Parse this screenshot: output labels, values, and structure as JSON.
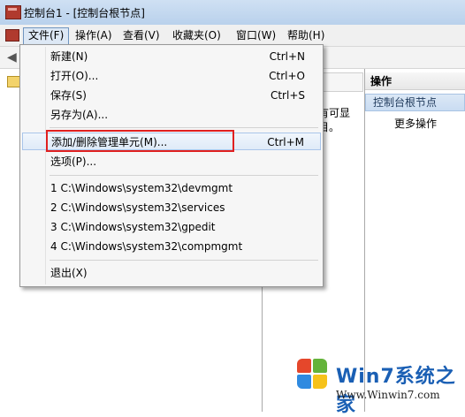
{
  "window": {
    "title": "控制台1 - [控制台根节点]"
  },
  "menubar": {
    "items": [
      {
        "label": "文件(F)"
      },
      {
        "label": "操作(A)"
      },
      {
        "label": "查看(V)"
      },
      {
        "label": "收藏夹(O)"
      },
      {
        "label": "窗口(W)"
      },
      {
        "label": "帮助(H)"
      }
    ]
  },
  "middle": {
    "line1": "有可显",
    "line2": "目。"
  },
  "actions": {
    "header": "操作",
    "node": "控制台根节点",
    "more": "更多操作"
  },
  "file_menu": {
    "items": [
      {
        "label": "新建(N)",
        "shortcut": "Ctrl+N"
      },
      {
        "label": "打开(O)...",
        "shortcut": "Ctrl+O"
      },
      {
        "label": "保存(S)",
        "shortcut": "Ctrl+S"
      },
      {
        "label": "另存为(A)...",
        "shortcut": ""
      },
      {
        "label": "添加/删除管理单元(M)...",
        "shortcut": "Ctrl+M"
      },
      {
        "label": "选项(P)...",
        "shortcut": ""
      },
      {
        "label": "1 C:\\Windows\\system32\\devmgmt",
        "shortcut": ""
      },
      {
        "label": "2 C:\\Windows\\system32\\services",
        "shortcut": ""
      },
      {
        "label": "3 C:\\Windows\\system32\\gpedit",
        "shortcut": ""
      },
      {
        "label": "4 C:\\Windows\\system32\\compmgmt",
        "shortcut": ""
      },
      {
        "label": "退出(X)",
        "shortcut": ""
      }
    ]
  },
  "watermark": {
    "brand": "Win7系统之家",
    "url": "Www.Winwin7.com"
  },
  "icons": [
    "app-icon",
    "back-arrow-icon",
    "folder-icon",
    "windows-logo-icon"
  ]
}
